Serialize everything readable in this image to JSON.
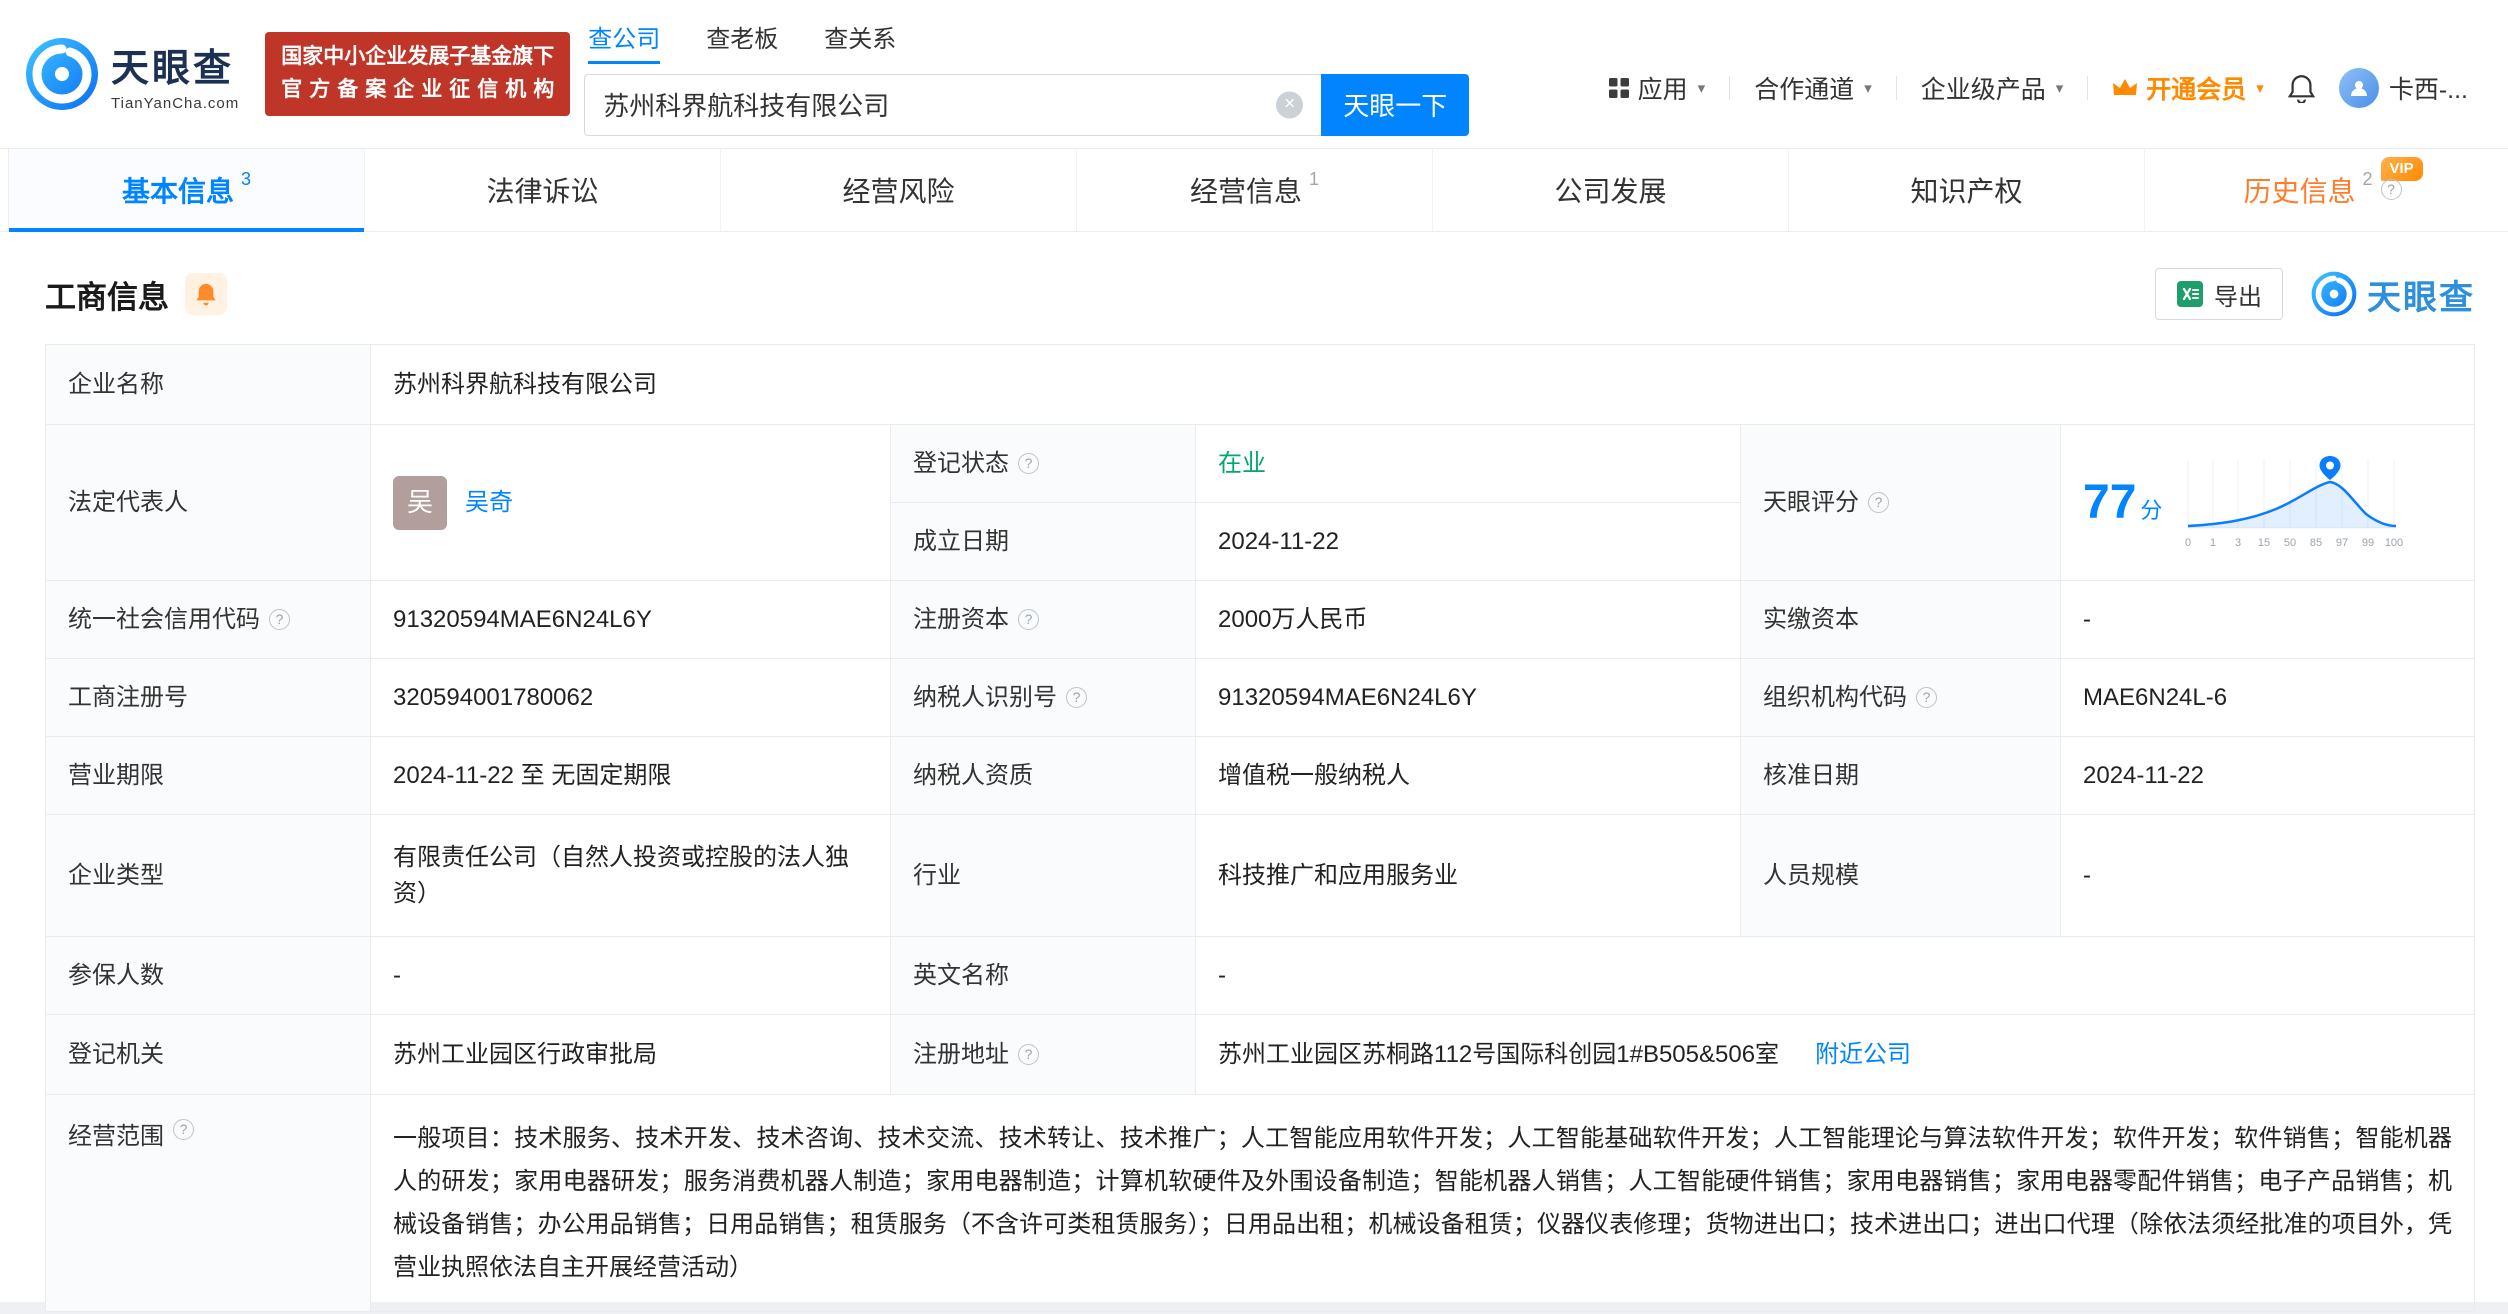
{
  "colors": {
    "brand_blue": "#0084ff",
    "vip_orange": "#ff8a00",
    "status_green": "#00a870",
    "badge_red": "#bf3528"
  },
  "header": {
    "logo_title": "天眼查",
    "logo_domain": "TianYanCha.com",
    "badge": {
      "line1": "国家中小企业发展子基金旗下",
      "line2": "官方备案企业征信机构"
    },
    "search_tabs": [
      {
        "label": "查公司"
      },
      {
        "label": "查老板"
      },
      {
        "label": "查关系"
      }
    ],
    "search_value": "苏州科界航科技有限公司",
    "search_button": "天眼一下",
    "nav": {
      "apps": "应用",
      "cooperation": "合作通道",
      "enterprise": "企业级产品",
      "vip": "开通会员",
      "user": "卡西-..."
    }
  },
  "tabs": {
    "basic": {
      "label": "基本信息",
      "count": "3"
    },
    "legal": {
      "label": "法律诉讼"
    },
    "risk": {
      "label": "经营风险"
    },
    "operating": {
      "label": "经营信息",
      "count": "1"
    },
    "development": {
      "label": "公司发展"
    },
    "ip": {
      "label": "知识产权"
    },
    "history": {
      "label": "历史信息",
      "count": "2",
      "vip_tag": "VIP"
    }
  },
  "section": {
    "title": "工商信息",
    "export": "导出",
    "watermark": "天眼查"
  },
  "fields": {
    "company_name": {
      "label": "企业名称",
      "value": "苏州科界航科技有限公司"
    },
    "legal_rep": {
      "label": "法定代表人",
      "avatar": "吴",
      "value": "吴奇"
    },
    "reg_status": {
      "label": "登记状态",
      "value": "在业"
    },
    "establish_date": {
      "label": "成立日期",
      "value": "2024-11-22"
    },
    "score": {
      "label": "天眼评分",
      "value": "77",
      "unit": "分"
    },
    "credit_code": {
      "label": "统一社会信用代码",
      "value": "91320594MAE6N24L6Y"
    },
    "reg_capital": {
      "label": "注册资本",
      "value": "2000万人民币"
    },
    "paid_capital": {
      "label": "实缴资本",
      "value": "-"
    },
    "reg_number": {
      "label": "工商注册号",
      "value": "320594001780062"
    },
    "taxpayer_id": {
      "label": "纳税人识别号",
      "value": "91320594MAE6N24L6Y"
    },
    "org_code": {
      "label": "组织机构代码",
      "value": "MAE6N24L-6"
    },
    "business_term": {
      "label": "营业期限",
      "value": "2024-11-22 至 无固定期限"
    },
    "taxpayer_quality": {
      "label": "纳税人资质",
      "value": "增值税一般纳税人"
    },
    "approval_date": {
      "label": "核准日期",
      "value": "2024-11-22"
    },
    "company_type": {
      "label": "企业类型",
      "value": "有限责任公司（自然人投资或控股的法人独资）"
    },
    "industry": {
      "label": "行业",
      "value": "科技推广和应用服务业"
    },
    "staff_size": {
      "label": "人员规模",
      "value": "-"
    },
    "insured_count": {
      "label": "参保人数",
      "value": "-"
    },
    "english_name": {
      "label": "英文名称",
      "value": "-"
    },
    "reg_authority": {
      "label": "登记机关",
      "value": "苏州工业园区行政审批局"
    },
    "reg_address": {
      "label": "注册地址",
      "value": "苏州工业园区苏桐路112号国际科创园1#B505&506室",
      "link": "附近公司"
    },
    "business_scope": {
      "label": "经营范围",
      "value": "一般项目：技术服务、技术开发、技术咨询、技术交流、技术转让、技术推广；人工智能应用软件开发；人工智能基础软件开发；人工智能理论与算法软件开发；软件开发；软件销售；智能机器人的研发；家用电器研发；服务消费机器人制造；家用电器制造；计算机软硬件及外围设备制造；智能机器人销售；人工智能硬件销售；家用电器销售；家用电器零配件销售；电子产品销售；机械设备销售；办公用品销售；日用品销售；租赁服务（不含许可类租赁服务）；日用品出租；机械设备租赁；仪器仪表修理；货物进出口；技术进出口；进出口代理（除依法须经批准的项目外，凭营业执照依法自主开展经营活动）"
    }
  },
  "score_chart": {
    "type": "area",
    "ticks": [
      "0",
      "1",
      "3",
      "15",
      "50",
      "85",
      "97",
      "99",
      "100"
    ],
    "score": 77
  }
}
